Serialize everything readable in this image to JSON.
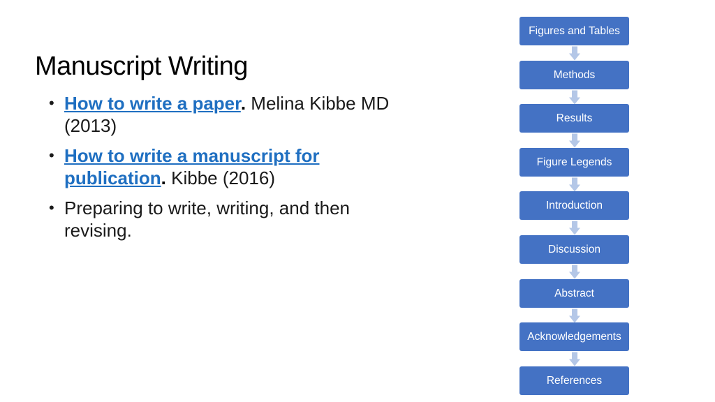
{
  "title": "Manuscript Writing",
  "bullets": [
    {
      "link": "How to write a paper",
      "sep": ".",
      "text": " Melina Kibbe MD (2013)"
    },
    {
      "link": "How to write a manuscript for publication",
      "sep": ".",
      "text": " Kibbe (2016)"
    },
    {
      "text": "Preparing to write, writing, and then revising."
    }
  ],
  "flow": {
    "steps": [
      "Figures and Tables",
      "Methods",
      "Results",
      "Figure Legends",
      "Introduction",
      "Discussion",
      "Abstract",
      "Acknowledgements",
      "References"
    ],
    "box_color": "#4472c4",
    "arrow_color": "#b4c7e7"
  },
  "colors": {
    "link": "#1f6fc1",
    "text": "#1a1a1a"
  }
}
